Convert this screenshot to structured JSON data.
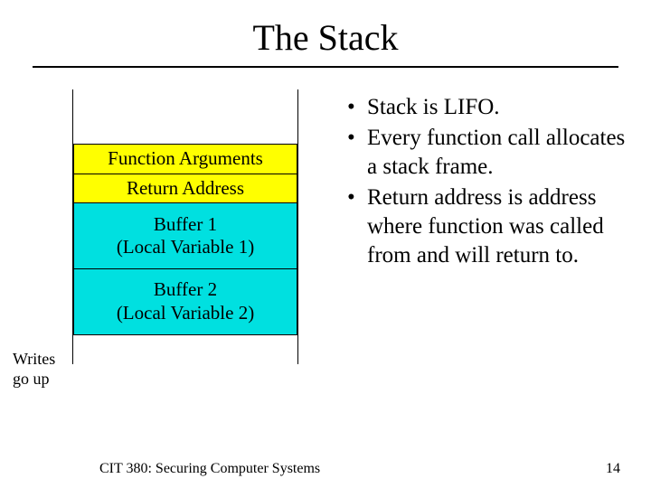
{
  "title": "The Stack",
  "stack": {
    "writes_label_l1": "Writes",
    "writes_label_l2": "go up",
    "cells": {
      "args": "Function Arguments",
      "ret": "Return Address",
      "buf1_l1": "Buffer 1",
      "buf1_l2": "(Local Variable 1)",
      "buf2_l1": "Buffer 2",
      "buf2_l2": "(Local Variable 2)"
    }
  },
  "bullets": {
    "b1": "Stack is LIFO.",
    "b2": "Every function call allocates a stack frame.",
    "b3": "Return address is address where function was called from and will return to."
  },
  "footer": {
    "course": "CIT 380: Securing Computer Systems",
    "page": "14"
  }
}
